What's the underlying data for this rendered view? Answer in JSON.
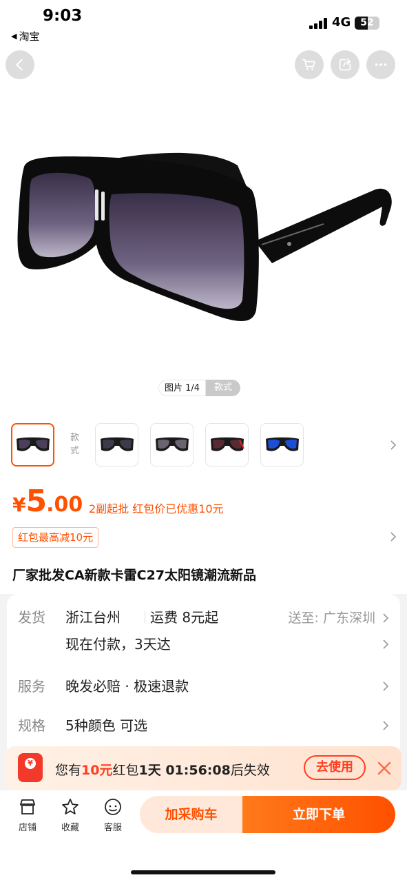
{
  "status_bar": {
    "time": "9:03",
    "back_app": "淘宝",
    "network": "4G",
    "battery_level": "52"
  },
  "nav": {
    "icons": [
      "back-arrow-icon",
      "cart-icon",
      "share-icon",
      "more-icon"
    ]
  },
  "gallery": {
    "pager_label": "图片 1/4",
    "style_tab": "款式"
  },
  "styles": {
    "label": "款式",
    "variants": [
      {
        "name": "black",
        "frame": "#1a1a1a",
        "lens": "#4b3f5c"
      },
      {
        "name": "black-silver",
        "frame": "#1a1a1a",
        "lens": "#3e3a4a"
      },
      {
        "name": "black-clear",
        "frame": "#1a1a1a",
        "lens": "#6a6470"
      },
      {
        "name": "black-red",
        "frame": "#1a1a1a",
        "lens": "#5a2a34"
      },
      {
        "name": "black-blue",
        "frame": "#1a1a1a",
        "lens": "#1d4fd6"
      }
    ]
  },
  "price": {
    "currency": "¥",
    "integer": "5",
    "decimal": ".00",
    "note": "2副起批  红包价已优惠10元"
  },
  "coupon_tag": "红包最高减10元",
  "title": "厂家批发CA新款卡雷C27太阳镜潮流新品",
  "info": {
    "shipping_label": "发货",
    "origin": "浙江台州",
    "fee": "运费 8元起",
    "ship_to": "送至: 广东深圳",
    "delivery": "现在付款，3天达",
    "service_label": "服务",
    "service": "晚发必赔 · 极速退款",
    "spec_label": "规格",
    "spec": "5种颜色 可选"
  },
  "banner": {
    "prefix": "您有",
    "amount": "10元",
    "mid": "红包",
    "time": "1天 01:56:08",
    "suffix": "后失效",
    "use_label": "去使用"
  },
  "bottom": {
    "shop": "店铺",
    "favorite": "收藏",
    "service": "客服",
    "add_cart": "加采购车",
    "buy_now": "立即下单"
  },
  "colors": {
    "accent": "#ff5000",
    "accent_red": "#ff3d1f"
  }
}
